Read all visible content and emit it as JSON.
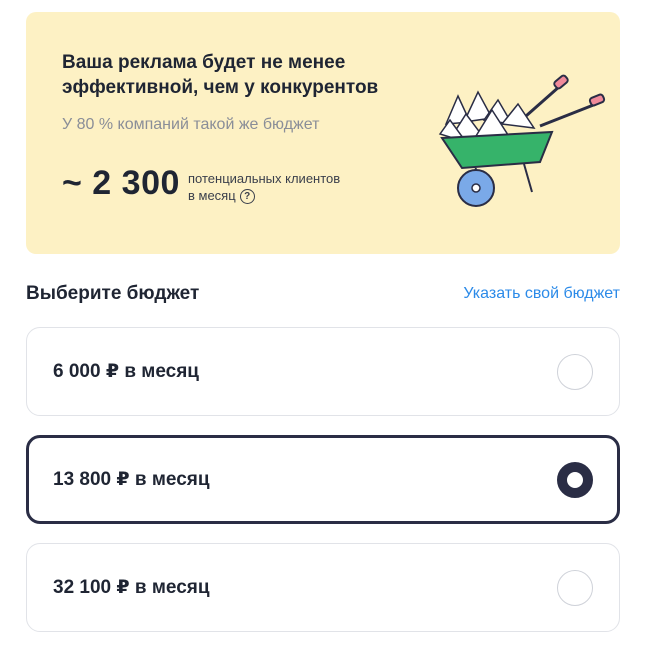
{
  "promo": {
    "title": "Ваша реклама будет не менее эффективной, чем у конкурентов",
    "subtitle": "У 80 % компаний такой же бюджет",
    "clients_number": "~ 2 300",
    "clients_desc_line1": "потенциальных клиентов",
    "clients_desc_line2": "в месяц",
    "help_icon": "?"
  },
  "budget": {
    "title": "Выберите бюджет",
    "custom_link": "Указать свой бюджет",
    "options": [
      {
        "label": "6 000 ₽ в месяц",
        "selected": false
      },
      {
        "label": "13 800 ₽ в месяц",
        "selected": true
      },
      {
        "label": "32 100 ₽ в месяц",
        "selected": false
      }
    ]
  },
  "colors": {
    "promo_bg": "#fdf1c4",
    "accent_link": "#2b8ae8",
    "selected_border": "#2a2d45",
    "wheelbarrow_green": "#36b36a",
    "wheel_blue": "#7aa9e8"
  }
}
